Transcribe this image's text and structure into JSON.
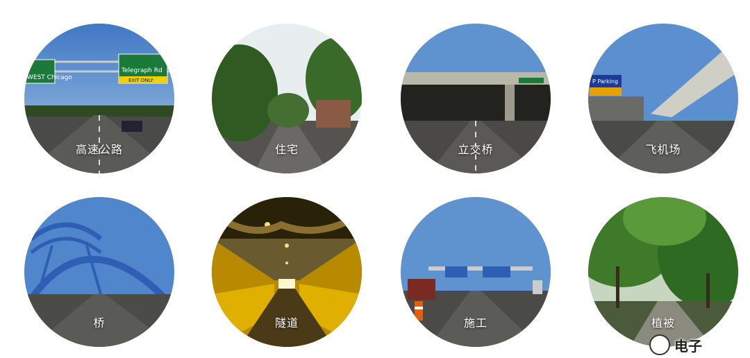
{
  "scenes": [
    {
      "label": "高速公路",
      "icon": "highway-scene",
      "sign_left": "WEST Chicago",
      "sign_right": "Telegraph Rd",
      "exit": "EXIT ONLY"
    },
    {
      "label": "住宅",
      "icon": "residential-scene"
    },
    {
      "label": "立交桥",
      "icon": "overpass-scene"
    },
    {
      "label": "飞机场",
      "icon": "airport-scene",
      "sign": "P Parking"
    },
    {
      "label": "桥",
      "icon": "bridge-scene"
    },
    {
      "label": "隧道",
      "icon": "tunnel-scene"
    },
    {
      "label": "施工",
      "icon": "construction-scene"
    },
    {
      "label": "植被",
      "icon": "vegetation-scene"
    }
  ],
  "watermark": {
    "text": "电子"
  },
  "colors": {
    "sky": "#5b8fcf",
    "road": "#3a3a3a",
    "tunnel": "#d9a400",
    "foliage": "#3f7a2a"
  }
}
